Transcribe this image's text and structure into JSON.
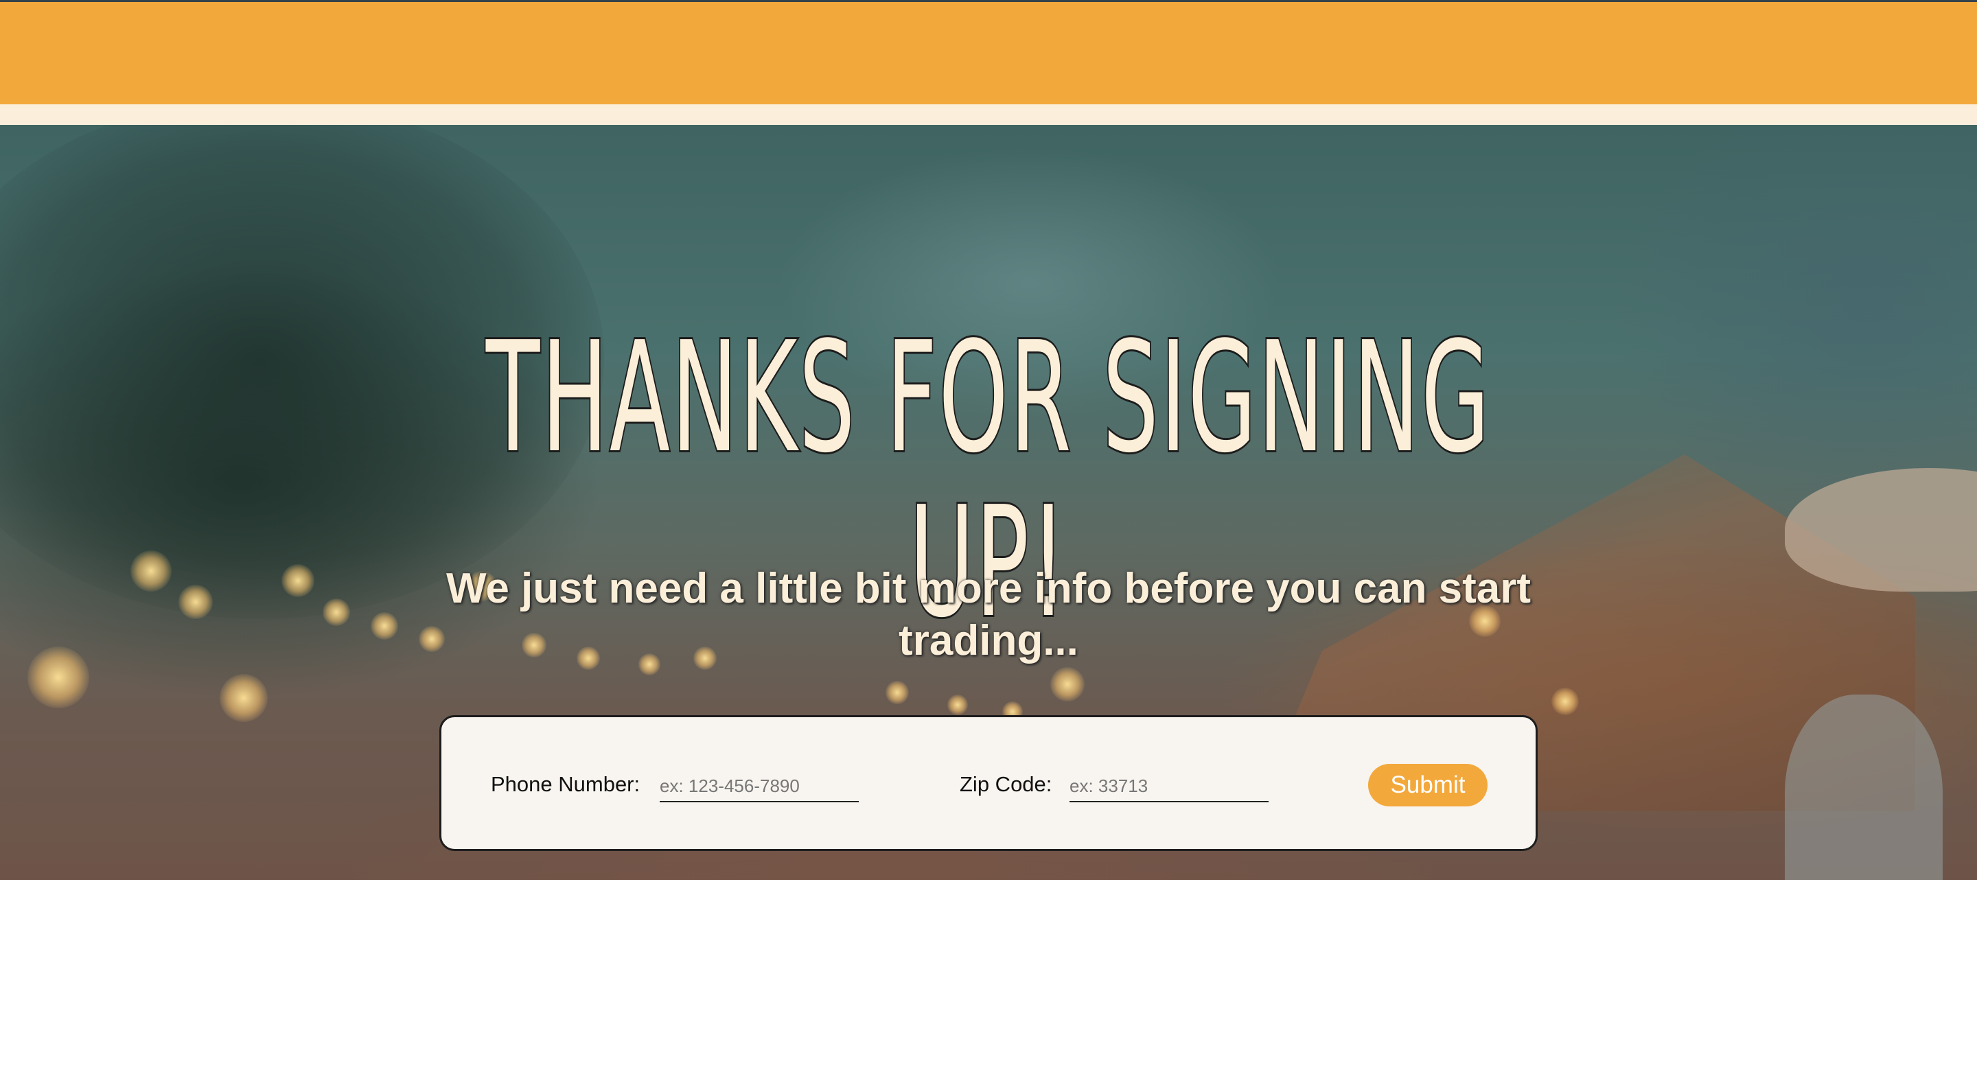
{
  "header": {
    "color": "#f3a83b"
  },
  "hero": {
    "title": "THANKS FOR SIGNING UP!",
    "subtitle": "We just need a little bit more info before you can start trading..."
  },
  "form": {
    "phone": {
      "label": "Phone Number:",
      "placeholder": "ex: 123-456-7890",
      "value": ""
    },
    "zip": {
      "label": "Zip Code:",
      "placeholder": "ex: 33713",
      "value": ""
    },
    "submit_label": "Submit"
  },
  "colors": {
    "accent": "#f3a83b",
    "cream": "#fcefd9",
    "card": "#f8f4ef"
  }
}
